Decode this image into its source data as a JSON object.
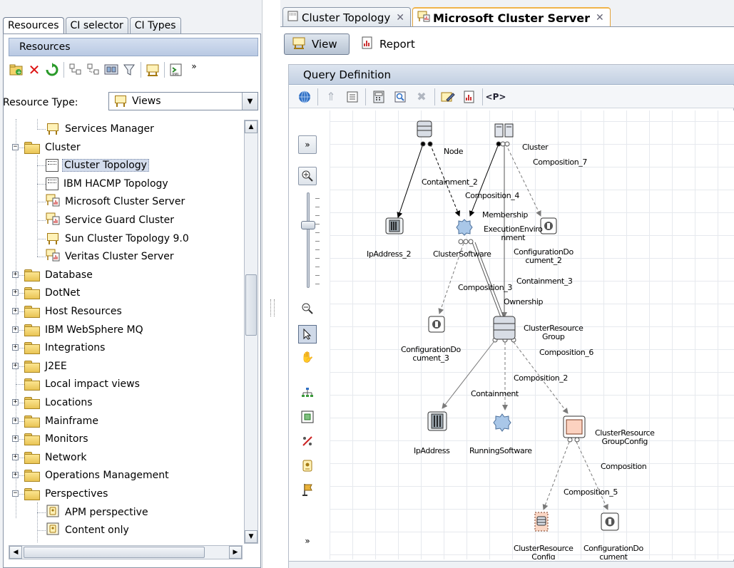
{
  "left": {
    "tabs": [
      "Resources",
      "CI selector",
      "CI Types"
    ],
    "header": "Resources",
    "toolbar_icons": [
      "new-folder-icon",
      "delete-icon",
      "refresh-icon",
      "expand-icon",
      "collapse-icon",
      "view-mode-icon",
      "filter-icon",
      "view-icon",
      "export-xml-icon",
      "more-icon"
    ],
    "resource_type_label": "Resource Type:",
    "resource_type_value": "Views",
    "tree": [
      {
        "label": "Services Manager",
        "icon": "view"
      },
      {
        "label": "Cluster",
        "icon": "folder"
      },
      {
        "label": "Cluster Topology",
        "icon": "doc",
        "selected": true
      },
      {
        "label": "IBM HACMP Topology",
        "icon": "doc"
      },
      {
        "label": "Microsoft Cluster Server",
        "icon": "report-view"
      },
      {
        "label": "Service Guard Cluster",
        "icon": "report-view"
      },
      {
        "label": "Sun Cluster Topology 9.0",
        "icon": "view"
      },
      {
        "label": "Veritas Cluster Server",
        "icon": "report-view"
      },
      {
        "label": "Database",
        "icon": "folder"
      },
      {
        "label": "DotNet",
        "icon": "folder"
      },
      {
        "label": "Host Resources",
        "icon": "folder"
      },
      {
        "label": "IBM WebSphere MQ",
        "icon": "folder"
      },
      {
        "label": "Integrations",
        "icon": "folder"
      },
      {
        "label": "J2EE",
        "icon": "folder"
      },
      {
        "label": "Local impact views",
        "icon": "folder"
      },
      {
        "label": "Locations",
        "icon": "folder"
      },
      {
        "label": "Mainframe",
        "icon": "folder"
      },
      {
        "label": "Monitors",
        "icon": "folder"
      },
      {
        "label": "Network",
        "icon": "folder"
      },
      {
        "label": "Operations Management",
        "icon": "folder"
      },
      {
        "label": "Perspectives",
        "icon": "folder"
      },
      {
        "label": "APM perspective",
        "icon": "perspective"
      },
      {
        "label": "Content only",
        "icon": "perspective"
      }
    ]
  },
  "right": {
    "tabs": [
      {
        "label": "Cluster Topology",
        "active": false
      },
      {
        "label": "Microsoft Cluster Server",
        "active": true
      }
    ],
    "view_button": "View",
    "report_button": "Report",
    "query_header": "Query Definition",
    "query_toolbar_icons": [
      "globe-icon",
      "up-icon",
      "properties-icon",
      "calculator-icon",
      "find-icon",
      "delete-icon",
      "edit-icon",
      "report-icon",
      "parameter-icon"
    ],
    "parameter_text": "<P>",
    "side_tools": [
      "expand-panel-icon",
      "zoom-in-icon",
      "zoom-out-icon",
      "select-icon",
      "pan-icon",
      "layout-icon",
      "fit-icon",
      "remove-icon",
      "badge-icon",
      "flag-icon",
      "collapse-panel-icon"
    ],
    "zoom_level": 0.3
  },
  "graph": {
    "nodes": {
      "node": "Node",
      "cluster": "Cluster",
      "ipaddress2": "IpAddress_2",
      "clustersoftware": "ClusterSoftware",
      "configdoc2": "ConfigurationDo\ncument_2",
      "configdoc3": "ConfigurationDo\ncument_3",
      "clusterresourcegroup": "ClusterResource\nGroup",
      "ipaddress": "IpAddress",
      "runningsoftware": "RunningSoftware",
      "clusterresourcegroupconfig": "ClusterResource\nGroupConfig",
      "clusterresourceconfig": "ClusterResource\nConfig",
      "configdoc": "ConfigurationDo\ncument"
    },
    "edges": {
      "containment2": "Containment_2",
      "composition4": "Composition_4",
      "composition7": "Composition_7",
      "membership": "Membership",
      "execution": "ExecutionEnviro\nnment",
      "containment3": "Containment_3",
      "composition3": "Composition_3",
      "ownership": "Ownership",
      "composition6": "Composition_6",
      "composition2": "Composition_2",
      "containment": "Containment",
      "composition": "Composition",
      "composition5": "Composition_5"
    }
  }
}
